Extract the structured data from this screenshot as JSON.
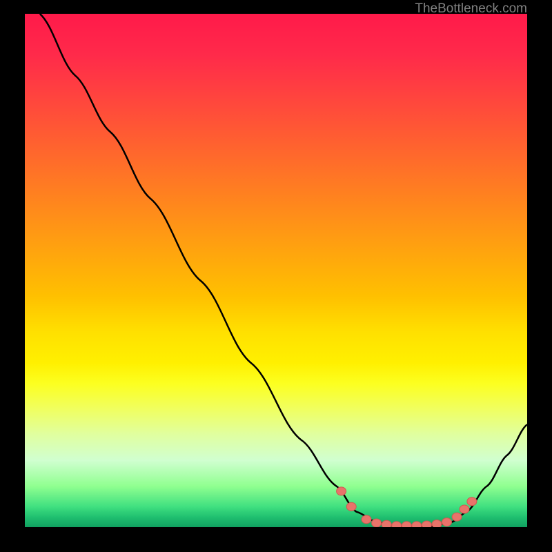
{
  "watermark": "TheBottleneck.com",
  "chart_data": {
    "type": "line",
    "title": "",
    "xlabel": "",
    "ylabel": "",
    "xlim": [
      0,
      100
    ],
    "ylim": [
      0,
      100
    ],
    "background_gradient": {
      "top": "#ff1a4a",
      "middle": "#ffe000",
      "bottom": "#20c070"
    },
    "series": [
      {
        "name": "curve",
        "points": [
          {
            "x": 3,
            "y": 100
          },
          {
            "x": 10,
            "y": 88
          },
          {
            "x": 17,
            "y": 77
          },
          {
            "x": 25,
            "y": 64
          },
          {
            "x": 35,
            "y": 48
          },
          {
            "x": 45,
            "y": 32
          },
          {
            "x": 55,
            "y": 17
          },
          {
            "x": 62,
            "y": 8
          },
          {
            "x": 66,
            "y": 3
          },
          {
            "x": 70,
            "y": 1
          },
          {
            "x": 75,
            "y": 0
          },
          {
            "x": 80,
            "y": 0
          },
          {
            "x": 85,
            "y": 1
          },
          {
            "x": 88,
            "y": 3
          },
          {
            "x": 92,
            "y": 8
          },
          {
            "x": 96,
            "y": 14
          },
          {
            "x": 100,
            "y": 20
          }
        ]
      }
    ],
    "markers": [
      {
        "x": 63,
        "y": 7
      },
      {
        "x": 65,
        "y": 4
      },
      {
        "x": 68,
        "y": 1.5
      },
      {
        "x": 70,
        "y": 0.8
      },
      {
        "x": 72,
        "y": 0.5
      },
      {
        "x": 74,
        "y": 0.3
      },
      {
        "x": 76,
        "y": 0.3
      },
      {
        "x": 78,
        "y": 0.3
      },
      {
        "x": 80,
        "y": 0.4
      },
      {
        "x": 82,
        "y": 0.6
      },
      {
        "x": 84,
        "y": 1
      },
      {
        "x": 86,
        "y": 2
      },
      {
        "x": 87.5,
        "y": 3.5
      },
      {
        "x": 89,
        "y": 5
      }
    ]
  }
}
